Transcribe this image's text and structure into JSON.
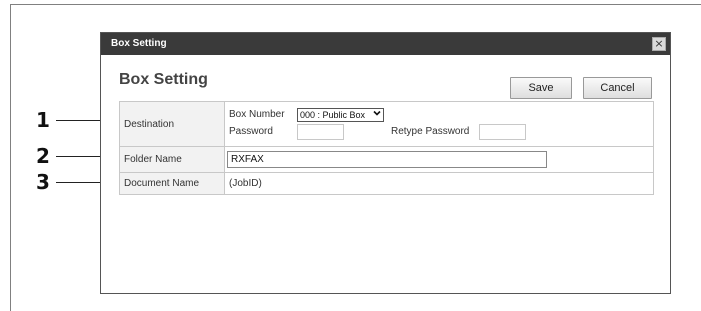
{
  "dialog": {
    "window_title": "Box Setting",
    "close_glyph": "×",
    "heading": "Box Setting",
    "save_label": "Save",
    "cancel_label": "Cancel"
  },
  "callouts": [
    "1",
    "2",
    "3"
  ],
  "form": {
    "destination": {
      "label": "Destination",
      "box_number_label": "Box Number",
      "box_number_value": "000 : Public Box",
      "password_label": "Password",
      "retype_password_label": "Retype Password"
    },
    "folder_name": {
      "label": "Folder Name",
      "value": "RXFAX"
    },
    "document_name": {
      "label": "Document Name",
      "value": "(JobID)"
    }
  },
  "icons": {
    "close": "close-icon",
    "dropdown": "chevron-down-icon"
  }
}
